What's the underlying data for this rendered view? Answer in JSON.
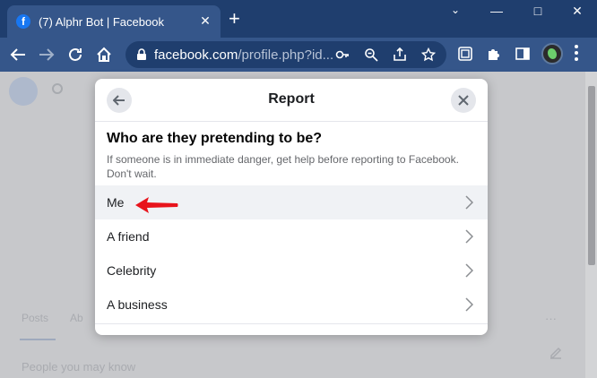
{
  "browser": {
    "tab_title": "(7) Alphr Bot | Facebook",
    "tab_close": "✕",
    "new_tab": "+",
    "url_host": "facebook.com",
    "url_path": "/profile.php?id...",
    "window_controls": {
      "minimize": "—",
      "maximize": "□",
      "close": "✕"
    }
  },
  "background": {
    "tab_posts": "Posts",
    "tab_about": "Ab",
    "people_you_may_know": "People you may know",
    "more": "···"
  },
  "dialog": {
    "title": "Report",
    "question": "Who are they pretending to be?",
    "help": "If someone is in immediate danger, get help before reporting to Facebook. Don't wait.",
    "options": [
      {
        "label": "Me"
      },
      {
        "label": "A friend"
      },
      {
        "label": "Celebrity"
      },
      {
        "label": "A business"
      }
    ],
    "highlight_color": "#f0f2f5"
  },
  "annotation": {
    "arrow_color": "#e8141c"
  }
}
